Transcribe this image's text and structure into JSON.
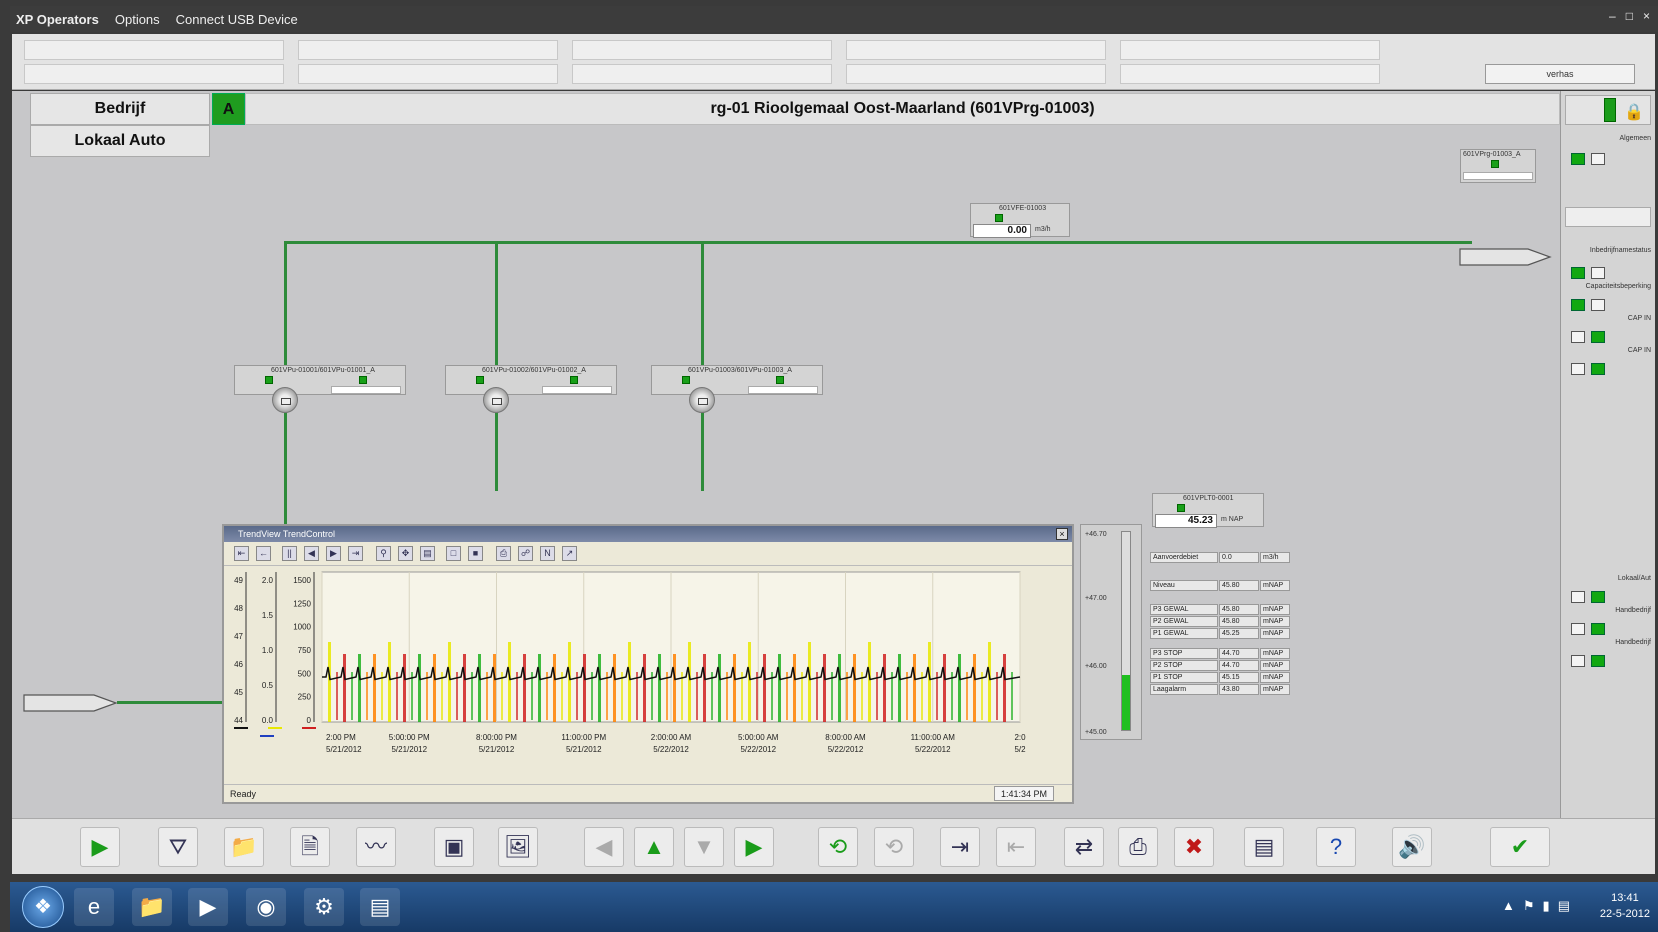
{
  "window": {
    "title": "XP Operators",
    "menu": [
      "Options",
      "Connect USB Device"
    ],
    "controls": [
      "–",
      "□",
      "×"
    ]
  },
  "toolbar_top": {
    "user_field": "verhas"
  },
  "header": {
    "mode_button_1": "Bedrijf",
    "mode_button_2": "Lokaal Auto",
    "status_letter": "A",
    "station_title": "rg-01 Rioolgemaal Oost-Maarland (601VPrg-01003)"
  },
  "process": {
    "flow_tag": "601VFE-01003",
    "flow_value": "0.00",
    "flow_unit": "m3/h",
    "level_tag": "601VPLT0-0001",
    "level_value": "45.23",
    "level_unit": "m NAP",
    "station_tag": "601VPrg-01003_A",
    "pumps": [
      {
        "tag": "601VPu-01001/601VPu-01001_A"
      },
      {
        "tag": "601VPu-01002/601VPu-01002_A"
      },
      {
        "tag": "601VPu-01003/601VPu-01003_A"
      }
    ],
    "readings": [
      {
        "label": "Aanvoerdebiet",
        "value": "0.0",
        "unit": "m3/h"
      },
      {
        "label": "Niveau",
        "value": "45.80",
        "unit": "mNAP"
      },
      {
        "label": "P3 GEWAL",
        "value": "45.80",
        "unit": "mNAP"
      },
      {
        "label": "P2 GEWAL",
        "value": "45.80",
        "unit": "mNAP"
      },
      {
        "label": "P1 GEWAL",
        "value": "45.25",
        "unit": "mNAP"
      },
      {
        "label": "P3 STOP",
        "value": "44.70",
        "unit": "mNAP"
      },
      {
        "label": "P2 STOP",
        "value": "44.70",
        "unit": "mNAP"
      },
      {
        "label": "P1 STOP",
        "value": "45.15",
        "unit": "mNAP"
      },
      {
        "label": "Laagalarm",
        "value": "43.80",
        "unit": "mNAP"
      }
    ],
    "gauge_ticks": [
      "+46.70",
      "+47.00",
      "+46.00",
      "+45.00"
    ],
    "gauge_level": 0.28
  },
  "right_panel": {
    "labels": [
      "Algemeen",
      "Inbedrijfnamestatus",
      "Capaciteitsbeperking",
      "CAP IN",
      "CAP IN",
      "Lokaal/Aut",
      "Handbedrijf",
      "Handbedrijf"
    ]
  },
  "trend": {
    "title": "TrendView TrendControl",
    "status": "Ready",
    "time": "1:41:34 PM",
    "colors": {
      "level": "#111111",
      "pump1": "#e8e800",
      "pump2": "#d02020",
      "pump3": "#20b020",
      "pump4": "#ff8000"
    }
  },
  "chart_data": {
    "type": "line",
    "title": "",
    "y_axes": [
      {
        "ticks": [
          "49",
          "48",
          "47",
          "46",
          "45",
          "44"
        ],
        "range": [
          43.5,
          49.5
        ]
      },
      {
        "ticks": [
          "2.0",
          "1.5",
          "1.0",
          "0.5",
          "0.0"
        ],
        "range": [
          0,
          2.0
        ]
      },
      {
        "ticks": [
          "1500",
          "1250",
          "1000",
          "750",
          "500",
          "250",
          "0"
        ],
        "range": [
          0,
          1500
        ]
      }
    ],
    "x_tick_labels": [
      [
        "2:00 PM",
        "5/21/2012"
      ],
      [
        "5:00:00 PM",
        "5/21/2012"
      ],
      [
        "8:00:00 PM",
        "5/21/2012"
      ],
      [
        "11:00:00 PM",
        "5/21/2012"
      ],
      [
        "2:00:00 AM",
        "5/22/2012"
      ],
      [
        "5:00:00 AM",
        "5/22/2012"
      ],
      [
        "8:00:00 AM",
        "5/22/2012"
      ],
      [
        "11:00:00 AM",
        "5/22/2012"
      ],
      [
        "2:0",
        "5/2"
      ]
    ],
    "level_baseline": 45.3,
    "level_peak": 45.7,
    "pulse_count": 46,
    "grid": true
  },
  "bottom_toolbar": {
    "icons": [
      "play-icon",
      "filter-icon",
      "folder-icon",
      "report-icon",
      "trend-icon",
      "window-icon",
      "picture-icon",
      "back-icon",
      "home-icon",
      "down-icon",
      "forward-icon",
      "refresh-icon",
      "refresh-disabled-icon",
      "login-icon",
      "logout-icon",
      "connect-icon",
      "print-icon",
      "stop-icon",
      "network-icon",
      "help-icon",
      "alarm-sound-icon",
      "acknowledge-icon"
    ]
  },
  "taskbar": {
    "time": "13:41",
    "date": "22-5-2012"
  }
}
